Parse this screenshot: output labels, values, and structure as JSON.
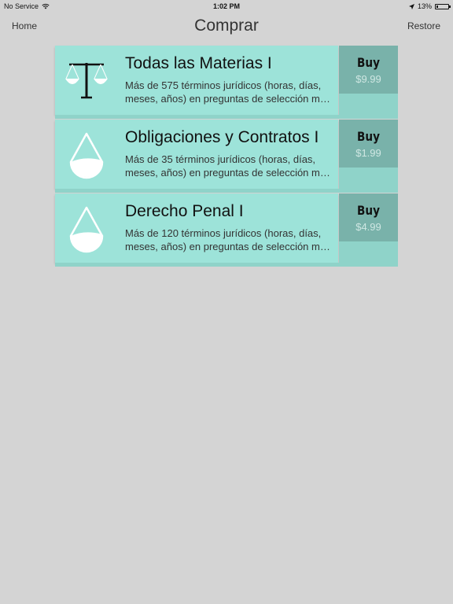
{
  "status_bar": {
    "carrier": "No Service",
    "time": "1:02 PM",
    "battery_percent": "13%",
    "battery_level": 0.13
  },
  "nav": {
    "left": "Home",
    "title": "Comprar",
    "right": "Restore"
  },
  "products": [
    {
      "icon": "scales-icon",
      "title": "Todas las Materias I",
      "desc_line1": "Más de 575 términos jurídicos (horas, días,",
      "desc_line2": "meses, años)  en preguntas de selección múltiple",
      "buy_label": "Buy",
      "price": "$9.99"
    },
    {
      "icon": "drop-icon",
      "title": "Obligaciones y Contratos I",
      "desc_line1": "Más de 35 términos jurídicos (horas, días,",
      "desc_line2": "meses, años) en preguntas de selección múltiple",
      "buy_label": "Buy",
      "price": "$1.99"
    },
    {
      "icon": "drop-icon",
      "title": "Derecho Penal I",
      "desc_line1": "Más de 120 términos jurídicos (horas, días,",
      "desc_line2": "meses, años) en preguntas de selección múltiple",
      "buy_label": "Buy",
      "price": "$4.99"
    }
  ],
  "colors": {
    "background": "#d4d4d4",
    "card": "#9de3d9",
    "buy_box": "#79b2aa",
    "card_strip": "#8fd3c9"
  }
}
